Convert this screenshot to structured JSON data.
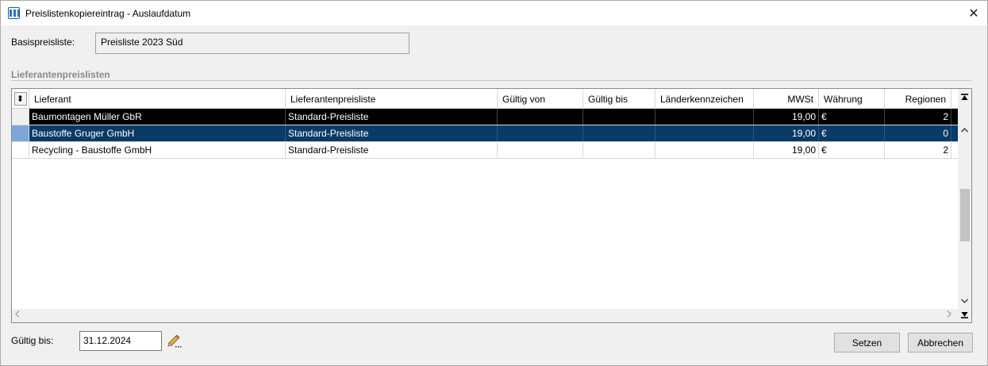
{
  "window": {
    "title": "Preislistenkopiereintrag - Auslaufdatum",
    "close_symbol": "✕"
  },
  "base": {
    "label": "Basispreisliste:",
    "value": "Preisliste 2023 Süd"
  },
  "section": {
    "title": "Lieferantenpreislisten"
  },
  "grid": {
    "sort_symbol": "⬍",
    "columns": [
      "Lieferant",
      "Lieferantenpreisliste",
      "Gültig von",
      "Gültig bis",
      "Länderkennzeichen",
      "MWSt",
      "Währung",
      "Regionen"
    ],
    "rows": [
      {
        "lieferant": "Baumontagen Müller GbR",
        "preisliste": "Standard-Preisliste",
        "gueltig_von": "",
        "gueltig_bis": "",
        "laender": "",
        "mwst": "19,00",
        "waehrung": "€",
        "regionen": "2",
        "state": "black"
      },
      {
        "lieferant": "Baustoffe Gruger GmbH",
        "preisliste": "Standard-Preisliste",
        "gueltig_von": "",
        "gueltig_bis": "",
        "laender": "",
        "mwst": "19,00",
        "waehrung": "€",
        "regionen": "0",
        "state": "selected"
      },
      {
        "lieferant": "Recycling - Baustoffe GmbH",
        "preisliste": "Standard-Preisliste",
        "gueltig_von": "",
        "gueltig_bis": "",
        "laender": "",
        "mwst": "19,00",
        "waehrung": "€",
        "regionen": "2",
        "state": "normal"
      }
    ],
    "colors": {
      "black_row": "#000000",
      "selected_row": "#0a3a66",
      "selected_indicator": "#7da7d9"
    }
  },
  "footer": {
    "valid_until_label": "Gültig bis:",
    "valid_until_value": "31.12.2024",
    "set_button": "Setzen",
    "cancel_button": "Abbrechen"
  }
}
